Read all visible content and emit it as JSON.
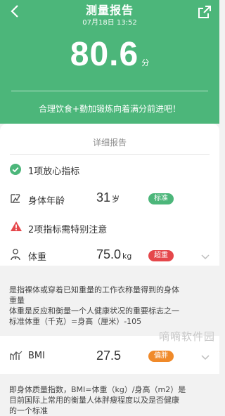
{
  "header": {
    "title": "测量报告",
    "datetime": "07月18日 13:52",
    "score": "80.6",
    "score_unit": "分",
    "advice": "合理饮食+勤加锻炼向着满分前进吧！"
  },
  "details": {
    "section_title": "详细报告",
    "safe_group": {
      "heading": "1项放心指标",
      "items": [
        {
          "label": "身体年龄",
          "value": "31",
          "unit": "岁",
          "badge": "标准",
          "badge_color": "#4cb67a"
        }
      ]
    },
    "warn_group": {
      "heading": "2项指标需特别注意",
      "items": [
        {
          "label": "体重",
          "value": "75.0",
          "unit": "kg",
          "badge": "超重",
          "badge_color": "#e5474b",
          "desc_lines": [
            "是指裸体或穿着已知重量的工作衣称量得到的身体",
            "重量",
            "体重是反应和衡量一个人健康状况的重要标志之一",
            "标准体重（千克）=身高（厘米）-105"
          ]
        },
        {
          "label": "BMI",
          "value": "27.5",
          "unit": "",
          "badge": "偏胖",
          "badge_color": "#f08a2a",
          "desc_lines": [
            "即身体质量指数，BMI=体重（kg）/身高（m2）是",
            "目前国际上常用的衡量人体胖瘦程度以及是否健康",
            "的一个标准"
          ]
        }
      ]
    }
  },
  "watermark": "嘀嘀软件园",
  "colors": {
    "primary": "#4cb67a",
    "warning": "#e5474b",
    "orange": "#f08a2a"
  }
}
